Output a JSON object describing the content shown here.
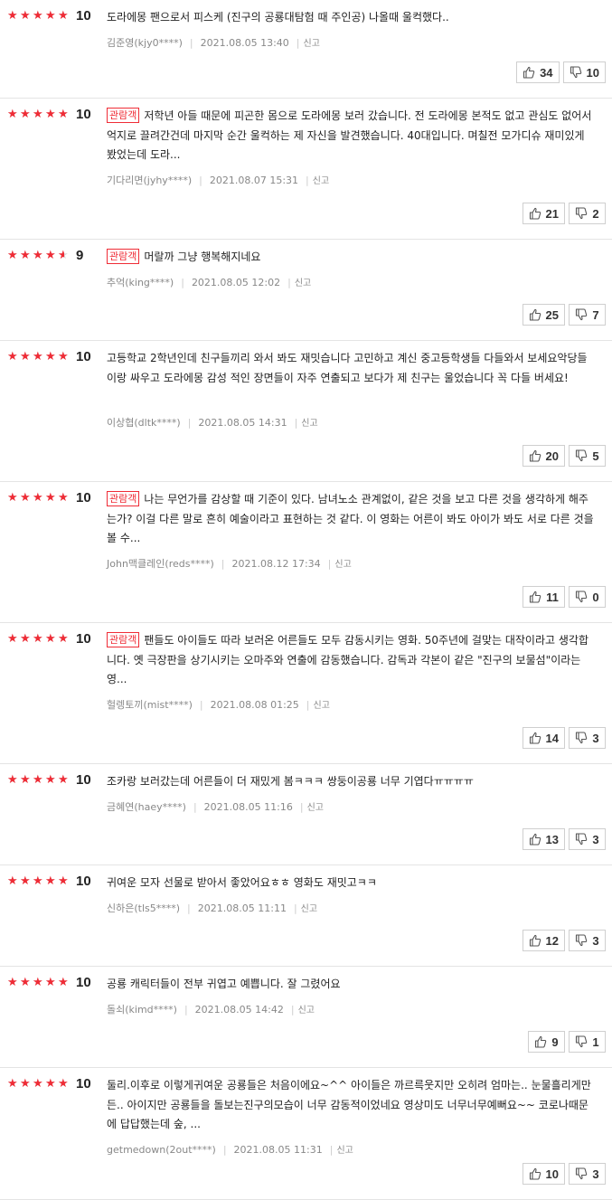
{
  "accent_color": "#ef2c36",
  "star_color": "#ef2c36",
  "report_label": "신고",
  "reviews": [
    {
      "rating": 10,
      "score": "10",
      "viewer_badge": false,
      "text": "도라에몽 팬으로서 피스케 (진구의 공룡대탐험 때 주인공) 나올때 울컥했다..",
      "author": "김준영(kjy0****)",
      "date": "2021.08.05 13:40",
      "likes": "34",
      "dislikes": "10"
    },
    {
      "rating": 10,
      "score": "10",
      "viewer_badge": true,
      "text": "저학년 아들 때문에 피곤한 몸으로 도라에몽 보러 갔습니다. 전 도라에몽 본적도 없고 관심도 없어서 억지로 끌려간건데 마지막 순간 울컥하는 제 자신을 발견했습니다. 40대입니다. 며칠전 모가디슈 재미있게 봤었는데 도라...",
      "author": "기다리면(jyhy****)",
      "date": "2021.08.07 15:31",
      "likes": "21",
      "dislikes": "2"
    },
    {
      "rating": 9,
      "score": "9",
      "viewer_badge": true,
      "text": "머랄까 그냥 행복해지네요",
      "author": "추억(king****)",
      "date": "2021.08.05 12:02",
      "likes": "25",
      "dislikes": "7"
    },
    {
      "rating": 10,
      "score": "10",
      "viewer_badge": false,
      "text": "고등학교 2학년인데 친구들끼리 와서 봐도 재밋습니다 고민하고 계신 중고등학생들 다들와서 보세요악당들이랑 싸우고 도라에몽 감성 적인 장면들이 자주 연출되고 보다가 제 친구는 울었습니다 꼭 다들 버세요!",
      "author": "이상협(dltk****)",
      "date": "2021.08.05 14:31",
      "likes": "20",
      "dislikes": "5"
    },
    {
      "rating": 10,
      "score": "10",
      "viewer_badge": true,
      "text": "나는 무언가를 감상할 때 기준이 있다. 남녀노소 관계없이, 같은 것을 보고 다른 것을 생각하게 해주는가? 이걸 다른 말로 흔히 예술이라고 표현하는 것 같다. 이 영화는 어른이 봐도 아이가 봐도 서로 다른 것을 볼 수...",
      "author": "John맥클레인(reds****)",
      "date": "2021.08.12 17:34",
      "likes": "11",
      "dislikes": "0"
    },
    {
      "rating": 10,
      "score": "10",
      "viewer_badge": true,
      "text": "팬들도 아이들도 따라 보러온 어른들도 모두 감동시키는 영화. 50주년에 걸맞는 대작이라고 생각합니다. 옛 극장판을 상기시키는 오마주와 연출에 감동했습니다. 감독과 각본이 같은 \"진구의 보물섬\"이라는 영...",
      "author": "헐렝토끼(mist****)",
      "date": "2021.08.08 01:25",
      "likes": "14",
      "dislikes": "3"
    },
    {
      "rating": 10,
      "score": "10",
      "viewer_badge": false,
      "text": "조카랑 보러갔는데 어른들이 더 재밌게 봄ㅋㅋㅋ 쌍둥이공룡 너무 기엽다ㅠㅠㅠㅠ",
      "author": "금혜연(haey****)",
      "date": "2021.08.05 11:16",
      "likes": "13",
      "dislikes": "3"
    },
    {
      "rating": 10,
      "score": "10",
      "viewer_badge": false,
      "text": "귀여운 모자 선물로 받아서 좋았어요ㅎㅎ 영화도 재밋고ㅋㅋ",
      "author": "신하은(tls5****)",
      "date": "2021.08.05 11:11",
      "likes": "12",
      "dislikes": "3"
    },
    {
      "rating": 10,
      "score": "10",
      "viewer_badge": false,
      "text": "공룡 캐릭터들이 전부 귀엽고 예쁩니다. 잘 그렸어요",
      "author": "돌쇠(kimd****)",
      "date": "2021.08.05 14:42",
      "likes": "9",
      "dislikes": "1"
    },
    {
      "rating": 10,
      "score": "10",
      "viewer_badge": false,
      "text": "둘리.이후로 이렇게귀여운 공룡들은 처음이에요~^^ 아이들은 까르륵웃지만 오히려 엄마는.. 눈물흘리게만든.. 아이지만 공룡들을 돌보는진구의모습이 너무 감동적이었네요 영상미도 너무너무예뻐요~~ 코로나때문에 답답했는데 숲, ...",
      "author": "getmedown(2out****)",
      "date": "2021.08.05 11:31",
      "likes": "10",
      "dislikes": "3"
    }
  ],
  "viewer_badge_label": "관람객"
}
